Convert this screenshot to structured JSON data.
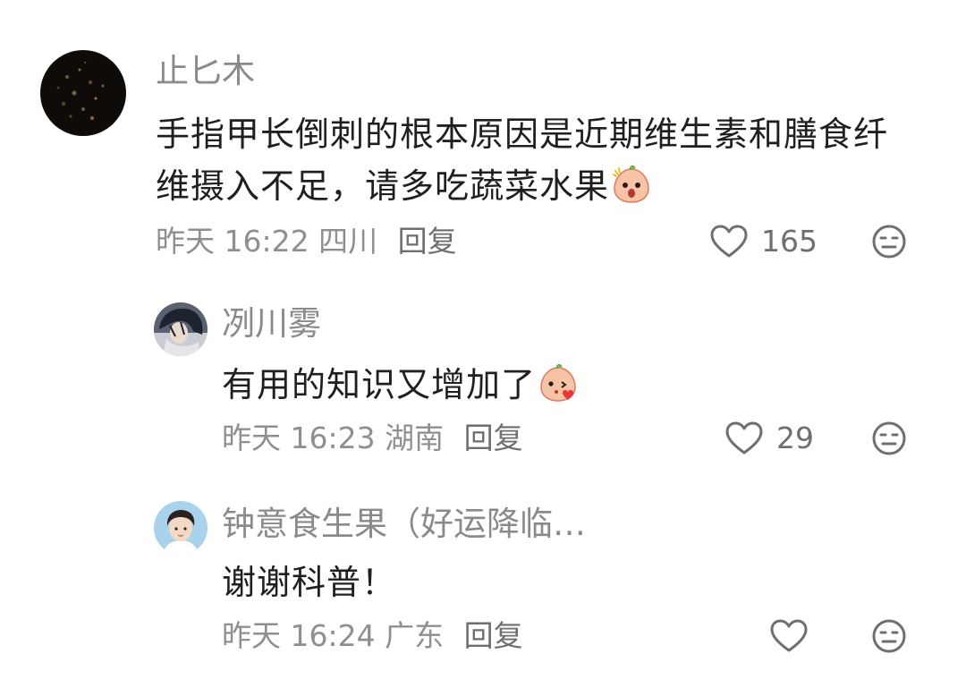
{
  "comments": [
    {
      "username": "止匕木",
      "content": "手指甲长倒刺的根本原因是近期维生素和膳食纤维摄入不足，请多吃蔬菜水果",
      "time": "昨天 16:22",
      "location": "四川",
      "reply_label": "回复",
      "likes": "165"
    },
    {
      "username": "冽川雾",
      "content": "有用的知识又增加了",
      "time": "昨天 16:23",
      "location": "湖南",
      "reply_label": "回复",
      "likes": "29"
    },
    {
      "username": "钟意食生果（好运降临…",
      "content": "谢谢科普！",
      "time": "昨天 16:24",
      "location": "广东",
      "reply_label": "回复",
      "likes": ""
    }
  ],
  "icons": {
    "like": "heart-outline-icon",
    "dislike": "neutral-face-icon",
    "emoji_1": "peach-sticker-shock-icon",
    "emoji_2": "peach-sticker-heart-icon"
  },
  "colors": {
    "username": "#8a8a8a",
    "content": "#1f1f1f",
    "meta": "#8f8f8f",
    "icon": "#6f6f6f"
  }
}
